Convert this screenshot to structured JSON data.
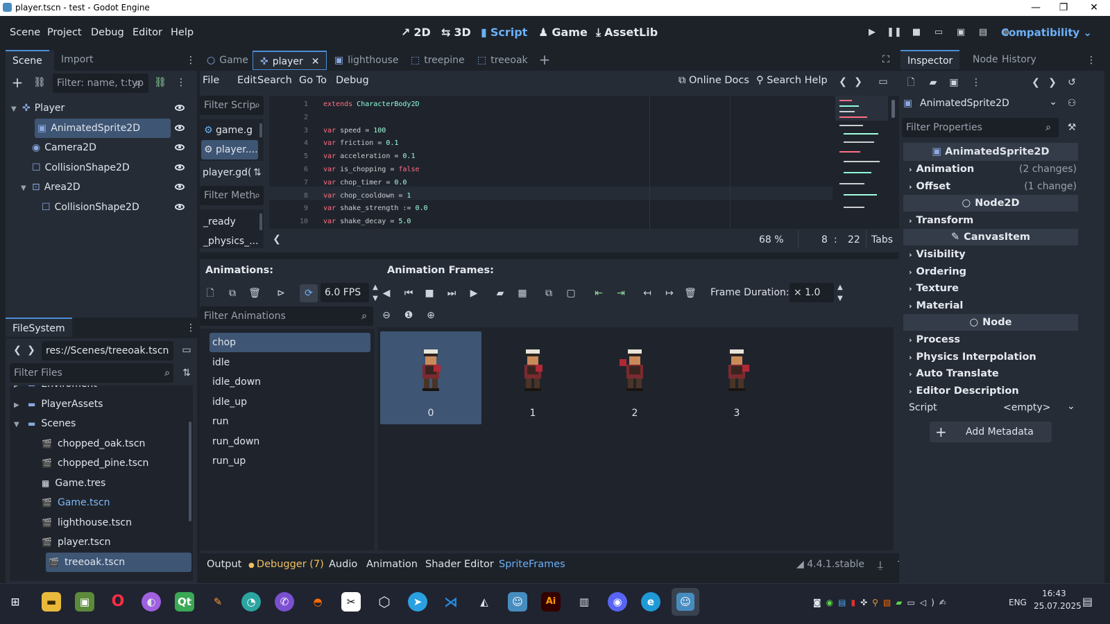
{
  "window": {
    "title": "player.tscn - test - Godot Engine",
    "controls": [
      "—",
      "❐",
      "✕"
    ]
  },
  "menu": {
    "items": [
      "Scene",
      "Project",
      "Debug",
      "Editor",
      "Help"
    ]
  },
  "workspaces": [
    {
      "label": "2D",
      "icon": "↗",
      "active": false
    },
    {
      "label": "3D",
      "icon": "⇆",
      "active": false
    },
    {
      "label": "Script",
      "icon": "▮",
      "active": true
    },
    {
      "label": "Game",
      "icon": "♟",
      "active": false
    },
    {
      "label": "AssetLib",
      "icon": "⤓",
      "active": false
    }
  ],
  "renderer": "Compatibility",
  "scene_dock": {
    "tabs": [
      "Scene",
      "Import"
    ],
    "filter_placeholder": "Filter: name, t:typ",
    "nodes": [
      {
        "label": "Player",
        "indent": 0,
        "icon": "player-icon",
        "selected": false
      },
      {
        "label": "AnimatedSprite2D",
        "indent": 1,
        "icon": "animated-sprite-icon",
        "selected": true
      },
      {
        "label": "Camera2D",
        "indent": 1,
        "icon": "camera-icon",
        "selected": false
      },
      {
        "label": "CollisionShape2D",
        "indent": 1,
        "icon": "collision-shape-icon",
        "selected": false
      },
      {
        "label": "Area2D",
        "indent": 1,
        "icon": "area-icon",
        "selected": false
      },
      {
        "label": "CollisionShape2D",
        "indent": 2,
        "icon": "collision-shape-icon",
        "selected": false
      }
    ]
  },
  "filesystem": {
    "tab": "FileSystem",
    "path": "res://Scenes/treeoak.tscn",
    "filter_placeholder": "Filter Files",
    "items": [
      {
        "label": "Enviroment",
        "indent": 1,
        "type": "folder"
      },
      {
        "label": "PlayerAssets",
        "indent": 1,
        "type": "folder"
      },
      {
        "label": "Scenes",
        "indent": 1,
        "type": "folder-open"
      },
      {
        "label": "chopped_oak.tscn",
        "indent": 2,
        "type": "scene"
      },
      {
        "label": "chopped_pine.tscn",
        "indent": 2,
        "type": "scene"
      },
      {
        "label": "Game.tres",
        "indent": 2,
        "type": "resource"
      },
      {
        "label": "Game.tscn",
        "indent": 2,
        "type": "scene",
        "highlight": true
      },
      {
        "label": "lighthouse.tscn",
        "indent": 2,
        "type": "scene"
      },
      {
        "label": "player.tscn",
        "indent": 2,
        "type": "scene"
      },
      {
        "label": "treeoak.tscn",
        "indent": 2,
        "type": "scene",
        "selected": true
      }
    ]
  },
  "editor_tabs": [
    {
      "label": "Game",
      "active": false
    },
    {
      "label": "player",
      "active": true
    },
    {
      "label": "lighthouse",
      "active": false
    },
    {
      "label": "treepine",
      "active": false
    },
    {
      "label": "treeoak",
      "active": false
    }
  ],
  "script_menu": [
    "File",
    "Edit",
    "Search",
    "Go To",
    "Debug"
  ],
  "online_docs": "Online Docs",
  "search_help": "Search Help",
  "script_list": {
    "filter_placeholder": "Filter Scrip",
    "scripts": [
      "game.g",
      "player...."
    ],
    "current": "player.gd(",
    "methods_placeholder": "Filter Meth",
    "methods": [
      "_ready",
      "_physics_..."
    ]
  },
  "code": [
    {
      "n": "1",
      "parts": [
        [
          "kw",
          "extends "
        ],
        [
          "ty",
          "CharacterBody2D"
        ]
      ]
    },
    {
      "n": "2",
      "parts": []
    },
    {
      "n": "3",
      "parts": [
        [
          "kw",
          "var "
        ],
        [
          "txt",
          "speed = "
        ],
        [
          "num",
          "100"
        ]
      ]
    },
    {
      "n": "4",
      "parts": [
        [
          "kw",
          "var "
        ],
        [
          "txt",
          "friction = "
        ],
        [
          "num",
          "0.1"
        ]
      ]
    },
    {
      "n": "5",
      "parts": [
        [
          "kw",
          "var "
        ],
        [
          "txt",
          "acceleration = "
        ],
        [
          "num",
          "0.1"
        ]
      ]
    },
    {
      "n": "6",
      "parts": [
        [
          "kw",
          "var "
        ],
        [
          "txt",
          "is_chopping = "
        ],
        [
          "kw",
          "false"
        ]
      ]
    },
    {
      "n": "7",
      "parts": [
        [
          "kw",
          "var "
        ],
        [
          "txt",
          "chop_timer = "
        ],
        [
          "num",
          "0.0"
        ]
      ]
    },
    {
      "n": "8",
      "parts": [
        [
          "kw",
          "var "
        ],
        [
          "txt",
          "chop_cooldown = "
        ],
        [
          "num",
          "1"
        ]
      ]
    },
    {
      "n": "9",
      "parts": [
        [
          "kw",
          "var "
        ],
        [
          "txt",
          "shake_strength := "
        ],
        [
          "num",
          "0.0"
        ]
      ]
    },
    {
      "n": "10",
      "parts": [
        [
          "kw",
          "var "
        ],
        [
          "txt",
          "shake_decay = "
        ],
        [
          "num",
          "5.0"
        ]
      ]
    }
  ],
  "status": {
    "zoom": "68 %",
    "line": "8",
    "col": "22",
    "indent": "Tabs"
  },
  "sprite_frames": {
    "animations_label": "Animations:",
    "frames_label": "Animation Frames:",
    "fps": "6.0 FPS",
    "filter_placeholder": "Filter Animations",
    "animations": [
      "chop",
      "idle",
      "idle_down",
      "idle_up",
      "run",
      "run_down",
      "run_up"
    ],
    "selected_animation": "chop",
    "frame_duration_label": "Frame Duration:",
    "frame_duration": "× 1.0",
    "frames": [
      "0",
      "1",
      "2",
      "3"
    ]
  },
  "inspector": {
    "tabs": [
      "Inspector",
      "Node",
      "History"
    ],
    "object": "AnimatedSprite2D",
    "filter_placeholder": "Filter Properties",
    "header": "AnimatedSprite2D",
    "rows": [
      {
        "type": "group",
        "label": "Animation",
        "changes": "(2 changes)"
      },
      {
        "type": "group",
        "label": "Offset",
        "changes": "(1 change)"
      },
      {
        "type": "cat",
        "label": "Node2D"
      },
      {
        "type": "group",
        "label": "Transform",
        "changes": ""
      },
      {
        "type": "cat",
        "label": "CanvasItem"
      },
      {
        "type": "group",
        "label": "Visibility",
        "changes": ""
      },
      {
        "type": "group",
        "label": "Ordering",
        "changes": ""
      },
      {
        "type": "group",
        "label": "Texture",
        "changes": ""
      },
      {
        "type": "group",
        "label": "Material",
        "changes": ""
      },
      {
        "type": "cat",
        "label": "Node"
      },
      {
        "type": "group",
        "label": "Process",
        "changes": ""
      },
      {
        "type": "group",
        "label": "Physics Interpolation",
        "changes": ""
      },
      {
        "type": "group",
        "label": "Auto Translate",
        "changes": ""
      },
      {
        "type": "group",
        "label": "Editor Description",
        "changes": ""
      }
    ],
    "script_label": "Script",
    "script_value": "<empty>",
    "add_metadata": "Add Metadata"
  },
  "bottom_tabs": [
    "Output",
    "Debugger (7)",
    "Audio",
    "Animation",
    "Shader Editor",
    "SpriteFrames"
  ],
  "version": "4.4.1.stable",
  "tray": {
    "lang": "ENG",
    "time": "16:43",
    "date": "25.07.2025"
  },
  "colors": {
    "accent": "#6bb0f7",
    "panel": "#262c36",
    "bg": "#1d2229",
    "selection": "#3e5574"
  }
}
